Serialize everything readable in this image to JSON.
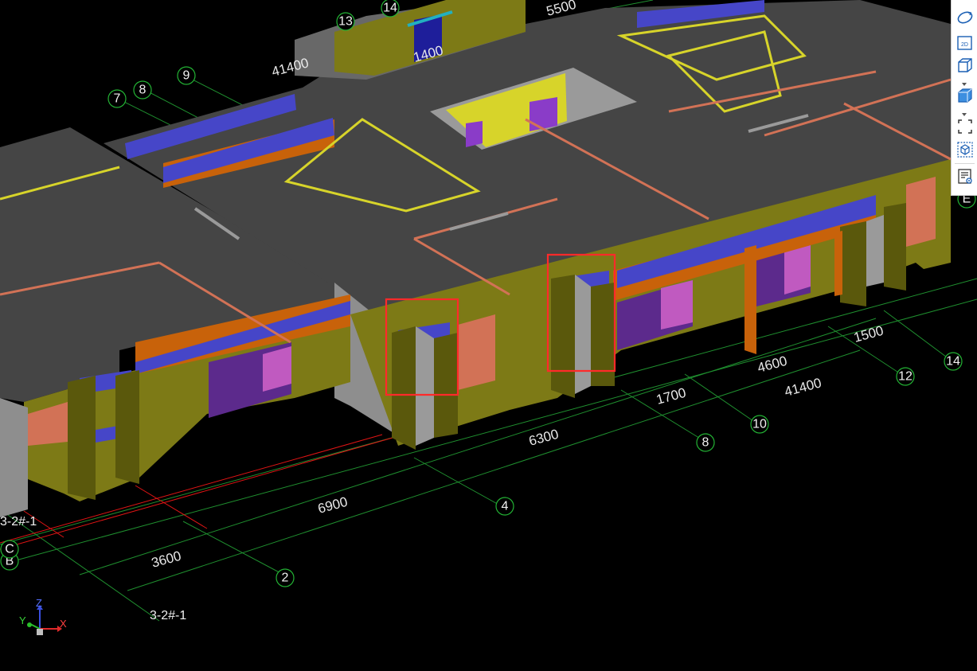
{
  "view": {
    "dimensions": [
      "5500",
      "41400",
      "6300",
      "6900",
      "3600",
      "1700",
      "4600",
      "41400",
      "1500"
    ],
    "axis_bubbles": [
      "7",
      "8",
      "9",
      "2",
      "4",
      "8",
      "10",
      "12",
      "14",
      "13",
      "14"
    ],
    "edge_labels": [
      "E",
      "B",
      "C"
    ],
    "floor_labels": [
      "3-2#-1",
      "3-2#-1"
    ],
    "partial_text": "1400"
  },
  "toolbar": {
    "buttons": [
      {
        "icon": "rotate-view-icon"
      },
      {
        "icon": "2d-view-icon",
        "label": "2D"
      },
      {
        "icon": "3d-wireframe-icon"
      },
      {
        "icon": "3d-solid-icon"
      },
      {
        "icon": "fullscreen-icon"
      },
      {
        "icon": "component-cube-icon"
      },
      {
        "icon": "properties-list-icon"
      }
    ]
  },
  "triad": {
    "x": "X",
    "y": "Y",
    "z": "Z"
  },
  "colors": {
    "background": "#000000",
    "slab": "#454545",
    "wall_olive": "#7d7a16",
    "beam_orange": "#c8620a",
    "blue": "#4646c8",
    "purple": "#7030a0",
    "selection": "#ff2a2a",
    "grid": "#1f8f2f"
  }
}
